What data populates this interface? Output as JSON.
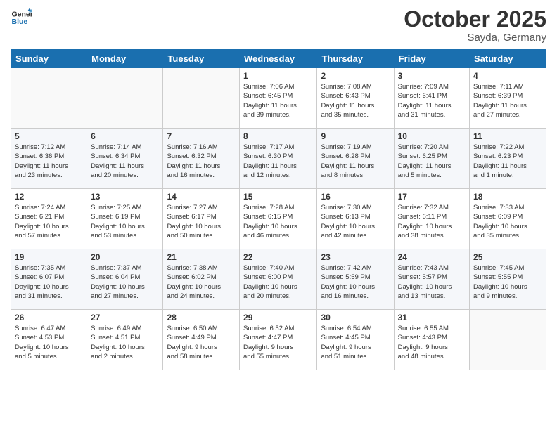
{
  "logo": {
    "line1": "General",
    "line2": "Blue"
  },
  "title": "October 2025",
  "location": "Sayda, Germany",
  "weekdays": [
    "Sunday",
    "Monday",
    "Tuesday",
    "Wednesday",
    "Thursday",
    "Friday",
    "Saturday"
  ],
  "weeks": [
    [
      {
        "day": "",
        "info": ""
      },
      {
        "day": "",
        "info": ""
      },
      {
        "day": "",
        "info": ""
      },
      {
        "day": "1",
        "info": "Sunrise: 7:06 AM\nSunset: 6:45 PM\nDaylight: 11 hours\nand 39 minutes."
      },
      {
        "day": "2",
        "info": "Sunrise: 7:08 AM\nSunset: 6:43 PM\nDaylight: 11 hours\nand 35 minutes."
      },
      {
        "day": "3",
        "info": "Sunrise: 7:09 AM\nSunset: 6:41 PM\nDaylight: 11 hours\nand 31 minutes."
      },
      {
        "day": "4",
        "info": "Sunrise: 7:11 AM\nSunset: 6:39 PM\nDaylight: 11 hours\nand 27 minutes."
      }
    ],
    [
      {
        "day": "5",
        "info": "Sunrise: 7:12 AM\nSunset: 6:36 PM\nDaylight: 11 hours\nand 23 minutes."
      },
      {
        "day": "6",
        "info": "Sunrise: 7:14 AM\nSunset: 6:34 PM\nDaylight: 11 hours\nand 20 minutes."
      },
      {
        "day": "7",
        "info": "Sunrise: 7:16 AM\nSunset: 6:32 PM\nDaylight: 11 hours\nand 16 minutes."
      },
      {
        "day": "8",
        "info": "Sunrise: 7:17 AM\nSunset: 6:30 PM\nDaylight: 11 hours\nand 12 minutes."
      },
      {
        "day": "9",
        "info": "Sunrise: 7:19 AM\nSunset: 6:28 PM\nDaylight: 11 hours\nand 8 minutes."
      },
      {
        "day": "10",
        "info": "Sunrise: 7:20 AM\nSunset: 6:25 PM\nDaylight: 11 hours\nand 5 minutes."
      },
      {
        "day": "11",
        "info": "Sunrise: 7:22 AM\nSunset: 6:23 PM\nDaylight: 11 hours\nand 1 minute."
      }
    ],
    [
      {
        "day": "12",
        "info": "Sunrise: 7:24 AM\nSunset: 6:21 PM\nDaylight: 10 hours\nand 57 minutes."
      },
      {
        "day": "13",
        "info": "Sunrise: 7:25 AM\nSunset: 6:19 PM\nDaylight: 10 hours\nand 53 minutes."
      },
      {
        "day": "14",
        "info": "Sunrise: 7:27 AM\nSunset: 6:17 PM\nDaylight: 10 hours\nand 50 minutes."
      },
      {
        "day": "15",
        "info": "Sunrise: 7:28 AM\nSunset: 6:15 PM\nDaylight: 10 hours\nand 46 minutes."
      },
      {
        "day": "16",
        "info": "Sunrise: 7:30 AM\nSunset: 6:13 PM\nDaylight: 10 hours\nand 42 minutes."
      },
      {
        "day": "17",
        "info": "Sunrise: 7:32 AM\nSunset: 6:11 PM\nDaylight: 10 hours\nand 38 minutes."
      },
      {
        "day": "18",
        "info": "Sunrise: 7:33 AM\nSunset: 6:09 PM\nDaylight: 10 hours\nand 35 minutes."
      }
    ],
    [
      {
        "day": "19",
        "info": "Sunrise: 7:35 AM\nSunset: 6:07 PM\nDaylight: 10 hours\nand 31 minutes."
      },
      {
        "day": "20",
        "info": "Sunrise: 7:37 AM\nSunset: 6:04 PM\nDaylight: 10 hours\nand 27 minutes."
      },
      {
        "day": "21",
        "info": "Sunrise: 7:38 AM\nSunset: 6:02 PM\nDaylight: 10 hours\nand 24 minutes."
      },
      {
        "day": "22",
        "info": "Sunrise: 7:40 AM\nSunset: 6:00 PM\nDaylight: 10 hours\nand 20 minutes."
      },
      {
        "day": "23",
        "info": "Sunrise: 7:42 AM\nSunset: 5:59 PM\nDaylight: 10 hours\nand 16 minutes."
      },
      {
        "day": "24",
        "info": "Sunrise: 7:43 AM\nSunset: 5:57 PM\nDaylight: 10 hours\nand 13 minutes."
      },
      {
        "day": "25",
        "info": "Sunrise: 7:45 AM\nSunset: 5:55 PM\nDaylight: 10 hours\nand 9 minutes."
      }
    ],
    [
      {
        "day": "26",
        "info": "Sunrise: 6:47 AM\nSunset: 4:53 PM\nDaylight: 10 hours\nand 5 minutes."
      },
      {
        "day": "27",
        "info": "Sunrise: 6:49 AM\nSunset: 4:51 PM\nDaylight: 10 hours\nand 2 minutes."
      },
      {
        "day": "28",
        "info": "Sunrise: 6:50 AM\nSunset: 4:49 PM\nDaylight: 9 hours\nand 58 minutes."
      },
      {
        "day": "29",
        "info": "Sunrise: 6:52 AM\nSunset: 4:47 PM\nDaylight: 9 hours\nand 55 minutes."
      },
      {
        "day": "30",
        "info": "Sunrise: 6:54 AM\nSunset: 4:45 PM\nDaylight: 9 hours\nand 51 minutes."
      },
      {
        "day": "31",
        "info": "Sunrise: 6:55 AM\nSunset: 4:43 PM\nDaylight: 9 hours\nand 48 minutes."
      },
      {
        "day": "",
        "info": ""
      }
    ]
  ]
}
